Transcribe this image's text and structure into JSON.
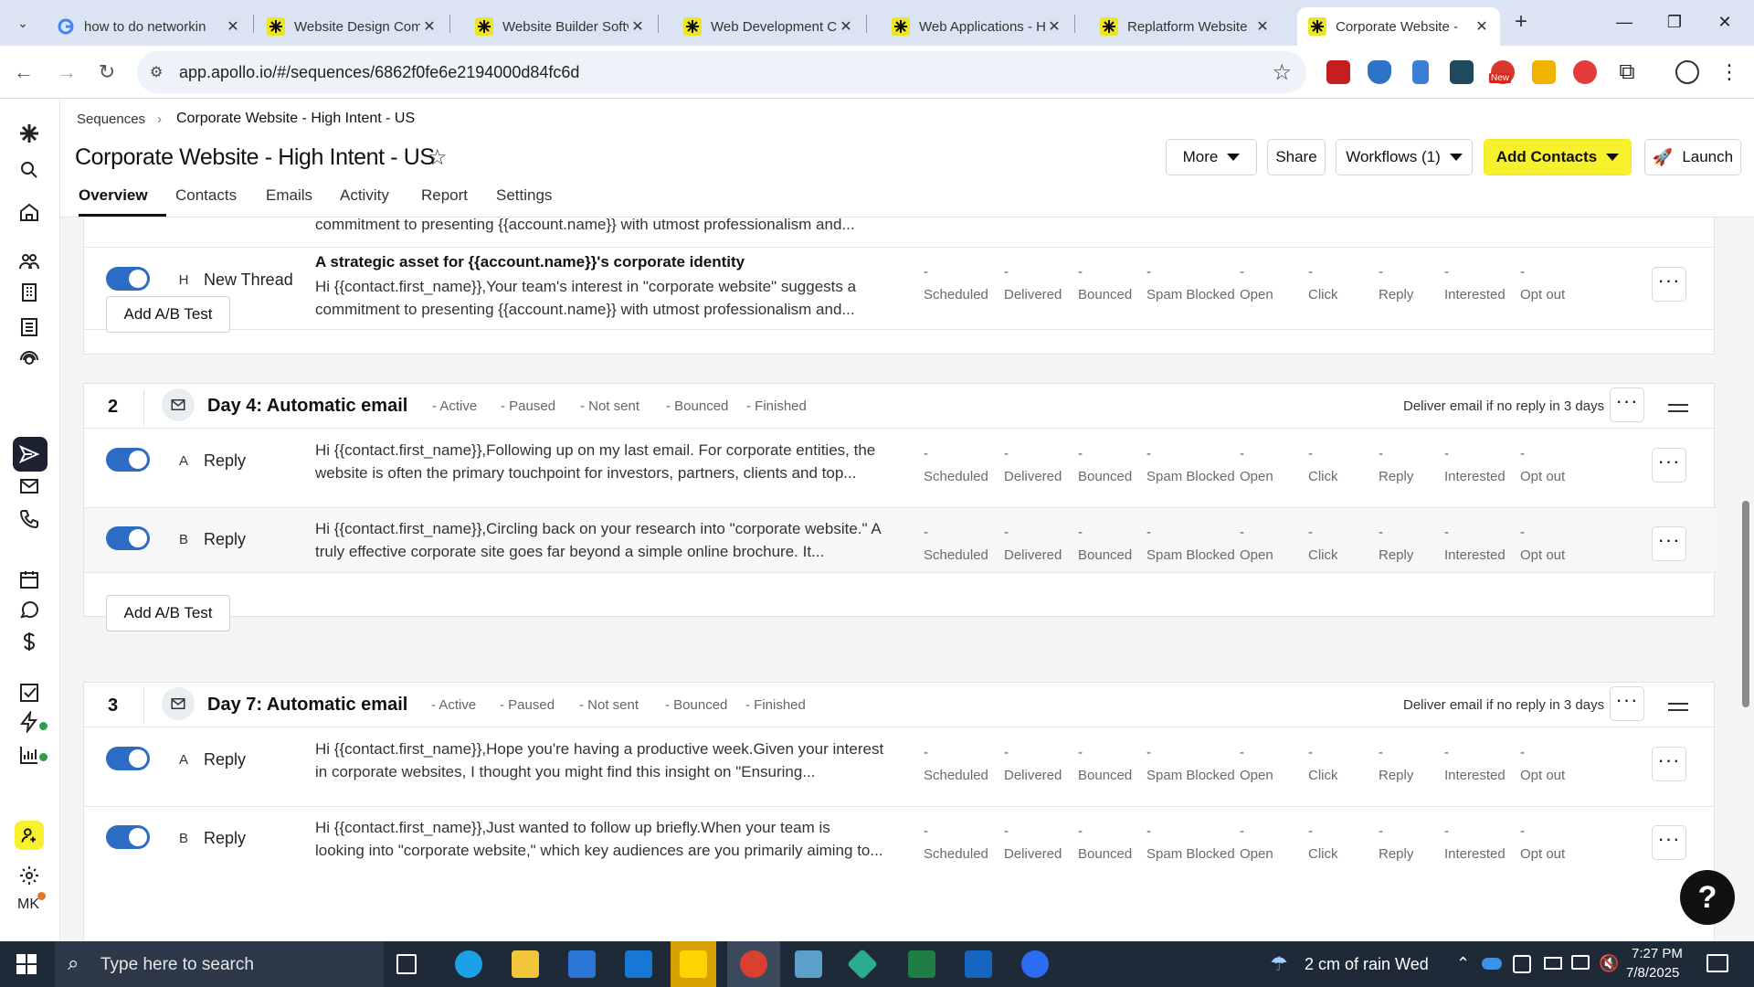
{
  "browser": {
    "tabs": [
      {
        "title": "how to do networkin",
        "active": false
      },
      {
        "title": "Website Design Com",
        "active": false
      },
      {
        "title": "Website Builder Softv",
        "active": false
      },
      {
        "title": "Web Development C",
        "active": false
      },
      {
        "title": "Web Applications - H",
        "active": false
      },
      {
        "title": "Replatform Website",
        "active": false
      },
      {
        "title": "Corporate Website -",
        "active": true
      }
    ],
    "url": "app.apollo.io/#/sequences/6862f0fe6e2194000d84fc6d",
    "ext_new_badge": "New"
  },
  "rail": {
    "avatar_initials": "MK"
  },
  "header": {
    "breadcrumb_root": "Sequences",
    "breadcrumb_current": "Corporate Website - High Intent - US",
    "title": "Corporate Website - High Intent - US",
    "buttons": {
      "more": "More",
      "share": "Share",
      "workflows": "Workflows (1)",
      "add_contacts": "Add Contacts",
      "launch": "Launch"
    },
    "tabs": [
      "Overview",
      "Contacts",
      "Emails",
      "Activity",
      "Report",
      "Settings"
    ]
  },
  "stat_labels": [
    "Scheduled",
    "Delivered",
    "Bounced",
    "Spam Blocked",
    "Open",
    "Click",
    "Reply",
    "Interested",
    "Opt out"
  ],
  "stat_value": "-",
  "add_ab_label": "Add A/B Test",
  "step1": {
    "top_partial_text": "commitment to presenting {{account.name}} with utmost professionalism and...",
    "row": {
      "variant": "H",
      "type": "New Thread",
      "subject": "A strategic asset for {{account.name}}'s corporate identity",
      "body_line1": "Hi {{contact.first_name}},Your team's interest in \"corporate website\" suggests a",
      "body_line2": "commitment to presenting {{account.name}} with utmost professionalism and..."
    }
  },
  "step2": {
    "number": "2",
    "title": "Day 4: Automatic email",
    "chips": [
      "- Active",
      "- Paused",
      "- Not sent",
      "- Bounced",
      "- Finished"
    ],
    "deliver": "Deliver email if no reply in 3 days",
    "rows": [
      {
        "variant": "A",
        "type": "Reply",
        "body_line1": "Hi {{contact.first_name}},Following up on my last email. For corporate entities, the",
        "body_line2": "website is often the primary touchpoint for investors, partners, clients and top..."
      },
      {
        "variant": "B",
        "type": "Reply",
        "body_line1": "Hi {{contact.first_name}},Circling back on your research into \"corporate website.\" A",
        "body_line2": "truly effective corporate site goes far beyond a simple online brochure. It..."
      }
    ]
  },
  "step3": {
    "number": "3",
    "title": "Day 7: Automatic email",
    "chips": [
      "- Active",
      "- Paused",
      "- Not sent",
      "- Bounced",
      "- Finished"
    ],
    "deliver": "Deliver email if no reply in 3 days",
    "rows": [
      {
        "variant": "A",
        "type": "Reply",
        "body_line1": "Hi {{contact.first_name}},Hope you're having a productive week.Given your interest",
        "body_line2": "in corporate websites, I thought you might find this insight on \"Ensuring..."
      },
      {
        "variant": "B",
        "type": "Reply",
        "body_line1": "Hi {{contact.first_name}},Just wanted to follow up briefly.When your team is",
        "body_line2": "looking into \"corporate website,\" which key audiences are you primarily aiming to..."
      }
    ]
  },
  "help_label": "?",
  "taskbar": {
    "search_placeholder": "Type here to search",
    "weather": "2 cm of rain Wed",
    "time": "7:27 PM",
    "date": "7/8/2025"
  },
  "colors": {
    "accent_yellow": "#f7f12d",
    "toggle_blue": "#2c6cc4",
    "rail_active": "#1d2230"
  }
}
